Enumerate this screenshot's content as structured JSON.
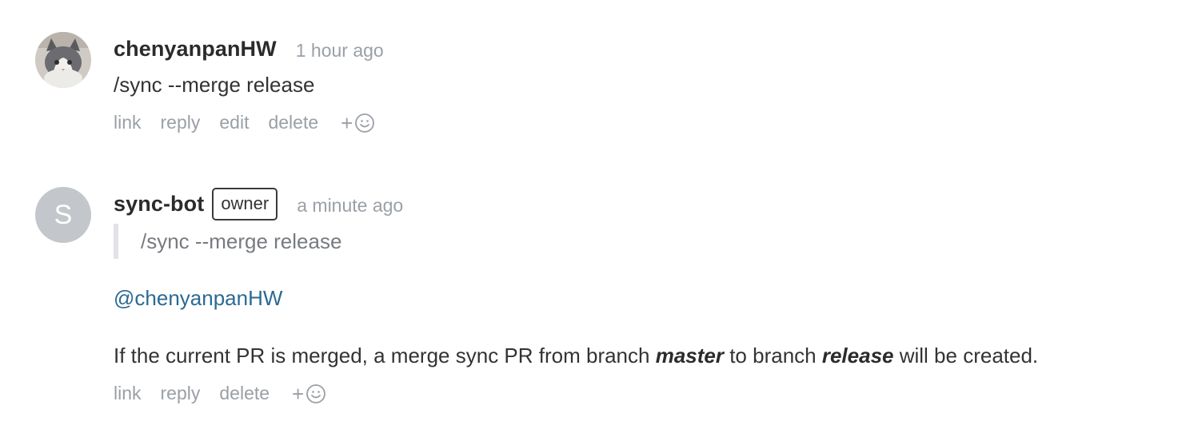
{
  "comments": [
    {
      "author": "chenyanpanHW",
      "time": "1 hour ago",
      "text": "/sync --merge release",
      "actions": [
        "link",
        "reply",
        "edit",
        "delete"
      ],
      "avatar_icon": "cat-photo-avatar"
    },
    {
      "author": "sync-bot",
      "avatar_letter": "S",
      "role": "owner",
      "time": "a minute ago",
      "quote": "/sync --merge release",
      "mention": "@chenyanpanHW",
      "message": {
        "part1": "If the current PR is merged, a merge sync PR from branch ",
        "source_branch": "master",
        "part2": " to branch ",
        "target_branch": "release",
        "part3": " will be created."
      },
      "actions": [
        "link",
        "reply",
        "delete"
      ]
    }
  ],
  "reaction_plus": "+",
  "colors": {
    "link_blue": "#2a6a93",
    "muted_gray": "#9aa0a6",
    "avatar_gray": "#c3c7cb"
  }
}
